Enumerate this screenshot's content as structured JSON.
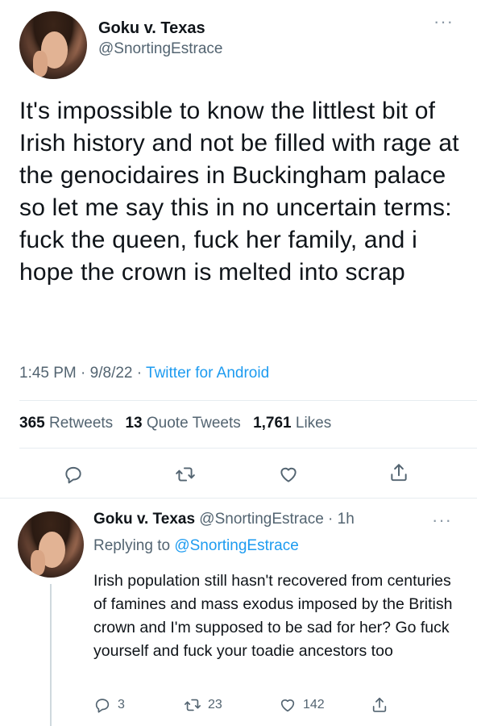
{
  "main_tweet": {
    "author_name": "Goku v. Texas",
    "author_handle": "@SnortingEstrace",
    "text": "It's impossible to know the littlest bit of Irish history and not be filled with rage at the genocidaires in Buckingham palace so let me say this in no uncertain terms: fuck the queen, fuck her family, and i hope the crown is melted into scrap",
    "time": "1:45 PM",
    "date": "9/8/22",
    "source": "Twitter for Android",
    "retweets_count": "365",
    "retweets_label": "Retweets",
    "quote_count": "13",
    "quote_label": "Quote Tweets",
    "likes_count": "1,761",
    "likes_label": "Likes"
  },
  "reply_tweet": {
    "author_name": "Goku v. Texas",
    "author_handle": "@SnortingEstrace",
    "age": "1h",
    "replying_prefix": "Replying to",
    "replying_to": "@SnortingEstrace",
    "text": "Irish population still hasn't recovered from centuries of famines and mass exodus imposed by the British crown and I'm supposed to be sad for her? Go fuck yourself and fuck your toadie ancestors too",
    "reply_count": "3",
    "retweet_count": "23",
    "like_count": "142"
  },
  "icons": {
    "more": "more-horizontal-icon",
    "reply": "reply-icon",
    "retweet": "retweet-icon",
    "like": "heart-icon",
    "share": "share-icon"
  },
  "colors": {
    "link": "#1d9bf0",
    "secondary_text": "#536471",
    "divider": "#e6ecf0"
  }
}
